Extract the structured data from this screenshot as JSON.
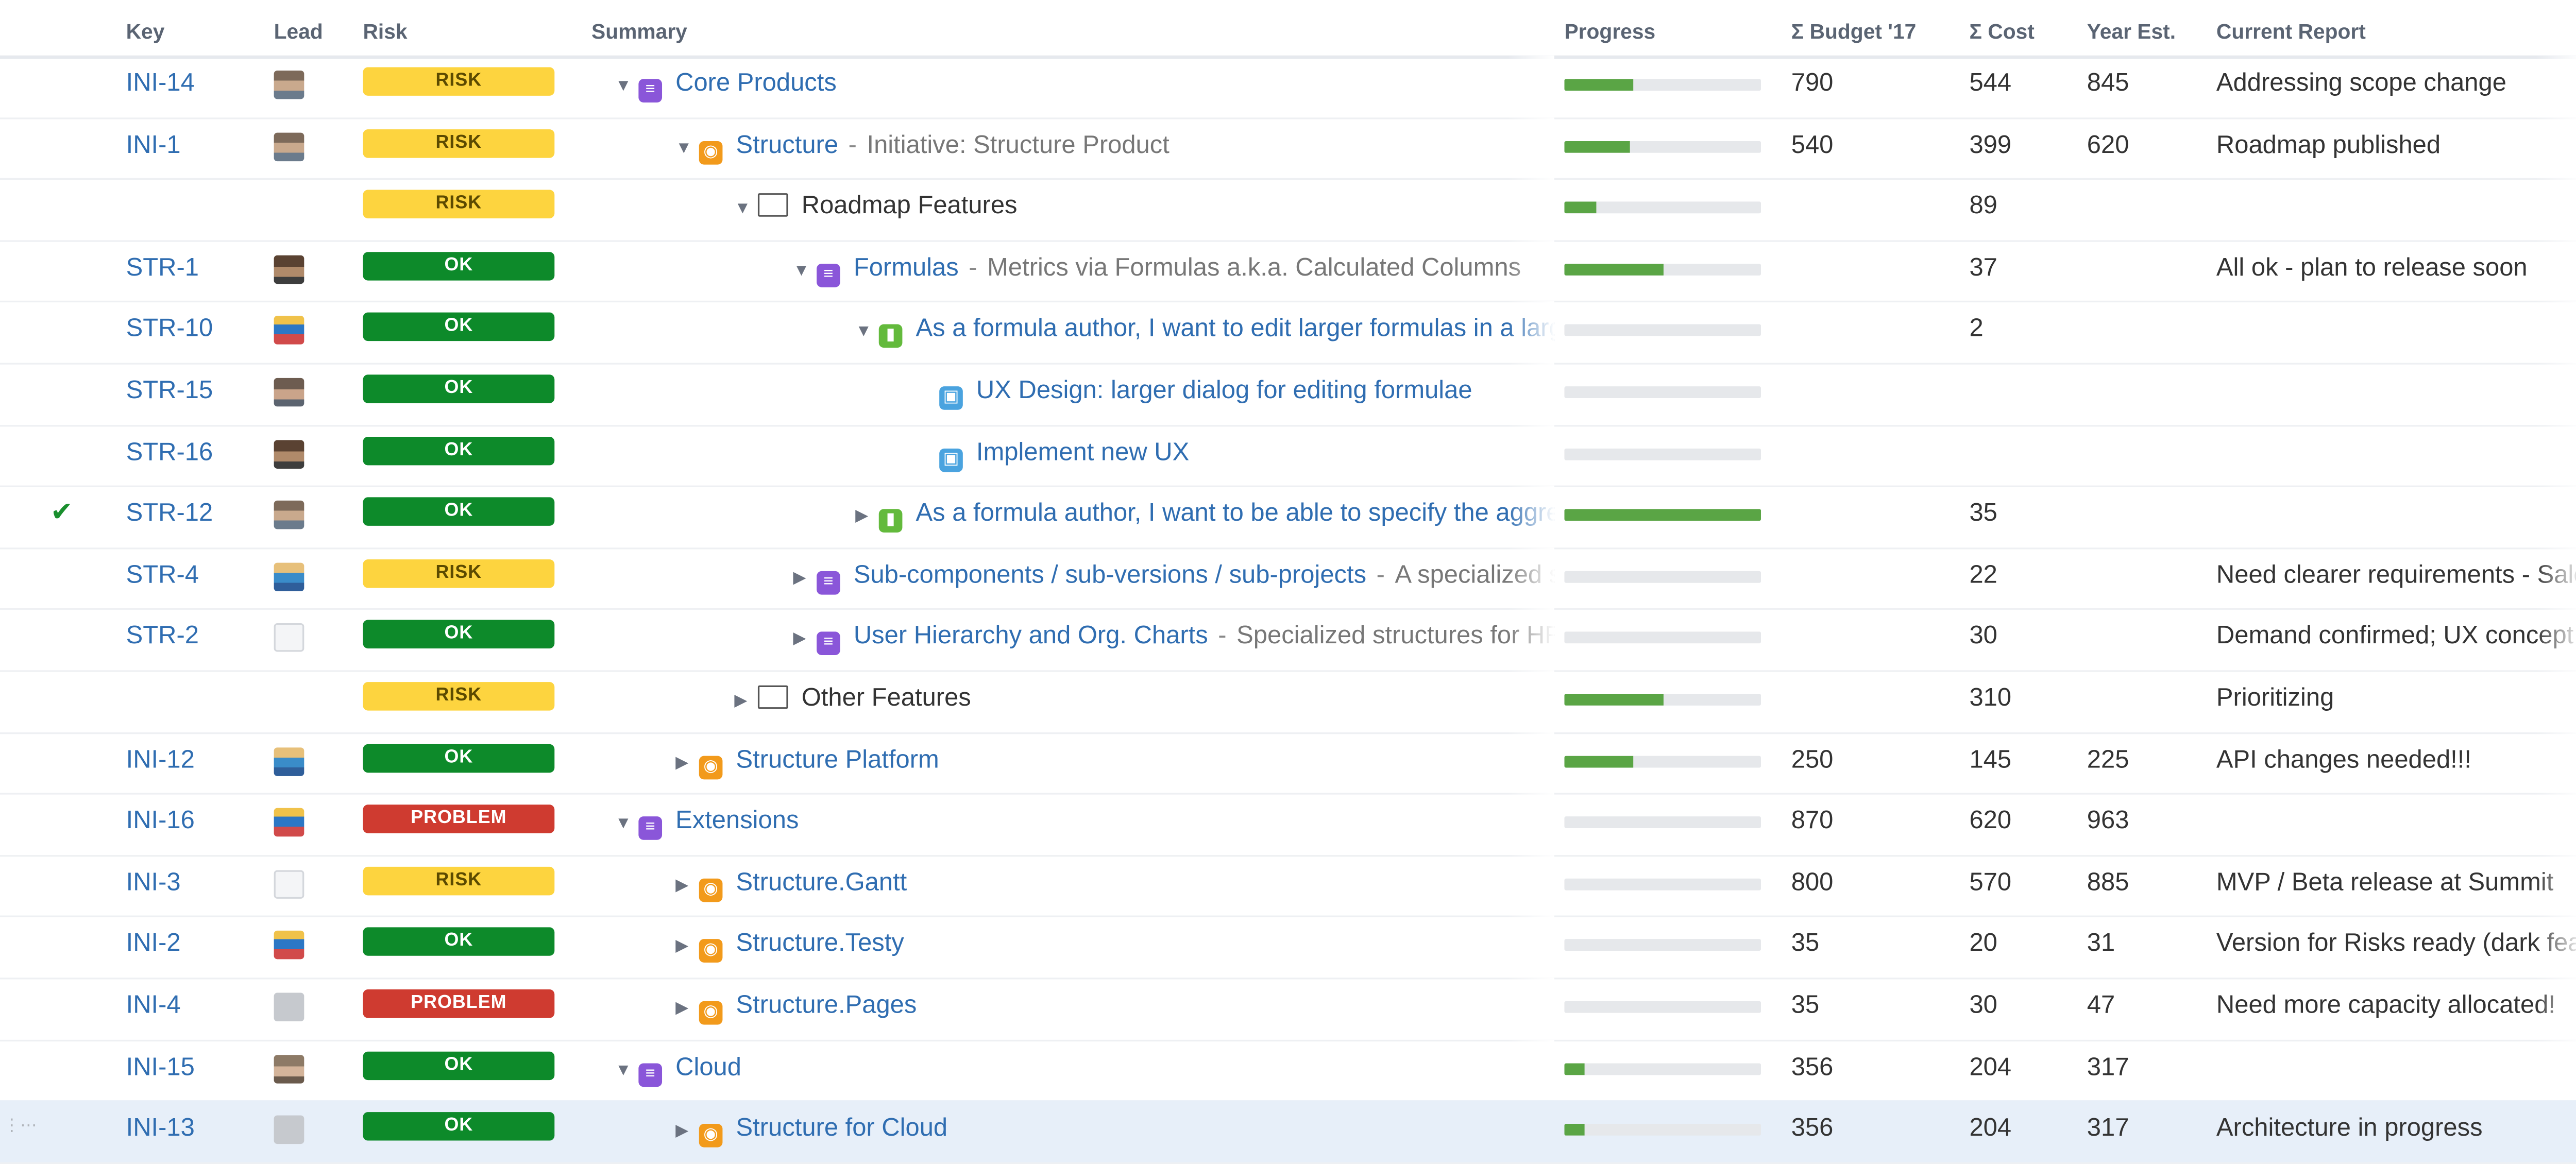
{
  "columns": {
    "key": "Key",
    "lead": "Lead",
    "risk": "Risk",
    "summary": "Summary",
    "progress": "Progress",
    "budget": "Σ Budget '17",
    "cost": "Σ Cost",
    "year": "Year Est.",
    "report": "Current Report"
  },
  "colors": {
    "link": "#2f6db1",
    "risk": "#fdd43f",
    "ok": "#0d8a2a",
    "problem": "#cf3b30",
    "progress_fill": "#5aa545",
    "epic": "#8a56d9",
    "initiative": "#f29a1b",
    "story": "#63ba3c",
    "task": "#4aa3df"
  },
  "rows": [
    {
      "key": "INI-14",
      "avatar": "a1",
      "risk": "RISK",
      "level": 0,
      "toggle": "expanded",
      "icon": "epic",
      "title": "Core Products",
      "desc": "",
      "progress": 0.35,
      "budget": "790",
      "cost": "544",
      "year": "845",
      "report": "Addressing scope change",
      "checked": false
    },
    {
      "key": "INI-1",
      "avatar": "a1",
      "risk": "RISK",
      "level": 1,
      "toggle": "expanded",
      "icon": "initiative",
      "title": "Structure",
      "desc": "Initiative: Structure Product",
      "progress": 0.33,
      "budget": "540",
      "cost": "399",
      "year": "620",
      "report": "Roadmap published",
      "checked": false
    },
    {
      "key": "",
      "avatar": "",
      "risk": "RISK",
      "level": 2,
      "toggle": "expanded",
      "icon": "folder",
      "title": "Roadmap Features",
      "desc": "",
      "progress": 0.16,
      "budget": "",
      "cost": "89",
      "year": "",
      "report": "",
      "checked": false
    },
    {
      "key": "STR-1",
      "avatar": "a2",
      "risk": "OK",
      "level": 3,
      "toggle": "expanded",
      "icon": "epic",
      "title": "Formulas",
      "desc": "Metrics via Formulas a.k.a. Calculated Columns",
      "progress": 0.5,
      "budget": "",
      "cost": "37",
      "year": "",
      "report": "All ok - plan to release soon",
      "checked": false
    },
    {
      "key": "STR-10",
      "avatar": "a3",
      "risk": "OK",
      "level": 4,
      "toggle": "expanded",
      "icon": "story",
      "title": "As a formula author, I want to edit larger formulas in a larger dialog",
      "desc": "",
      "progress": 0,
      "budget": "",
      "cost": "2",
      "year": "",
      "report": "",
      "checked": false
    },
    {
      "key": "STR-15",
      "avatar": "a7",
      "risk": "OK",
      "level": 5,
      "toggle": "none",
      "icon": "task",
      "title": "UX Design: larger dialog for editing formulae",
      "desc": "",
      "progress": 0,
      "budget": "",
      "cost": "",
      "year": "",
      "report": "",
      "checked": false
    },
    {
      "key": "STR-16",
      "avatar": "a2",
      "risk": "OK",
      "level": 5,
      "toggle": "none",
      "icon": "task",
      "title": "Implement new UX",
      "desc": "",
      "progress": 0,
      "budget": "",
      "cost": "",
      "year": "",
      "report": "",
      "checked": false
    },
    {
      "key": "STR-12",
      "avatar": "a1",
      "risk": "OK",
      "level": 4,
      "toggle": "collapsed",
      "icon": "story",
      "title": "As a formula author, I want to be able to specify the aggregation",
      "desc": "",
      "progress": 1.0,
      "budget": "",
      "cost": "35",
      "year": "",
      "report": "",
      "checked": true
    },
    {
      "key": "STR-4",
      "avatar": "a4",
      "risk": "RISK",
      "level": 3,
      "toggle": "collapsed",
      "icon": "epic",
      "title": "Sub-components / sub-versions / sub-projects",
      "desc": "A specialized structure",
      "progress": 0,
      "budget": "",
      "cost": "22",
      "year": "",
      "report": "Need clearer requirements - Sales",
      "checked": false
    },
    {
      "key": "STR-2",
      "avatar": "a5",
      "risk": "OK",
      "level": 3,
      "toggle": "collapsed",
      "icon": "epic",
      "title": "User Hierarchy and Org. Charts",
      "desc": "Specialized structures for HR",
      "progress": 0,
      "budget": "",
      "cost": "30",
      "year": "",
      "report": "Demand confirmed; UX concept ready",
      "checked": false
    },
    {
      "key": "",
      "avatar": "",
      "risk": "RISK",
      "level": 2,
      "toggle": "collapsed",
      "icon": "folder",
      "title": "Other Features",
      "desc": "",
      "progress": 0.5,
      "budget": "",
      "cost": "310",
      "year": "",
      "report": "Prioritizing",
      "checked": false
    },
    {
      "key": "INI-12",
      "avatar": "a4",
      "risk": "OK",
      "level": 1,
      "toggle": "collapsed",
      "icon": "initiative",
      "title": "Structure Platform",
      "desc": "",
      "progress": 0.35,
      "budget": "250",
      "cost": "145",
      "year": "225",
      "report": "API changes needed!!!",
      "checked": false
    },
    {
      "key": "INI-16",
      "avatar": "a3",
      "risk": "PROBLEM",
      "level": 0,
      "toggle": "expanded",
      "icon": "epic",
      "title": "Extensions",
      "desc": "",
      "progress": 0,
      "budget": "870",
      "cost": "620",
      "year": "963",
      "report": "",
      "checked": false
    },
    {
      "key": "INI-3",
      "avatar": "a5",
      "risk": "RISK",
      "level": 1,
      "toggle": "collapsed",
      "icon": "initiative",
      "title": "Structure.Gantt",
      "desc": "",
      "progress": 0,
      "budget": "800",
      "cost": "570",
      "year": "885",
      "report": "MVP / Beta release at Summit",
      "checked": false
    },
    {
      "key": "INI-2",
      "avatar": "a3",
      "risk": "OK",
      "level": 1,
      "toggle": "collapsed",
      "icon": "initiative",
      "title": "Structure.Testy",
      "desc": "",
      "progress": 0,
      "budget": "35",
      "cost": "20",
      "year": "31",
      "report": "Version for Risks ready (dark feature)",
      "checked": false
    },
    {
      "key": "INI-4",
      "avatar": "a6",
      "risk": "PROBLEM",
      "level": 1,
      "toggle": "collapsed",
      "icon": "initiative",
      "title": "Structure.Pages",
      "desc": "",
      "progress": 0,
      "budget": "35",
      "cost": "30",
      "year": "47",
      "report": "Need more capacity allocated!",
      "checked": false
    },
    {
      "key": "INI-15",
      "avatar": "a8",
      "risk": "OK",
      "level": 0,
      "toggle": "expanded",
      "icon": "epic",
      "title": "Cloud",
      "desc": "",
      "progress": 0.1,
      "budget": "356",
      "cost": "204",
      "year": "317",
      "report": "",
      "checked": false
    },
    {
      "key": "INI-13",
      "avatar": "a6",
      "risk": "OK",
      "level": 1,
      "toggle": "collapsed",
      "icon": "initiative",
      "title": "Structure for Cloud",
      "desc": "",
      "progress": 0.1,
      "budget": "356",
      "cost": "204",
      "year": "317",
      "report": "Architecture in progress",
      "checked": false,
      "selected": true
    }
  ]
}
